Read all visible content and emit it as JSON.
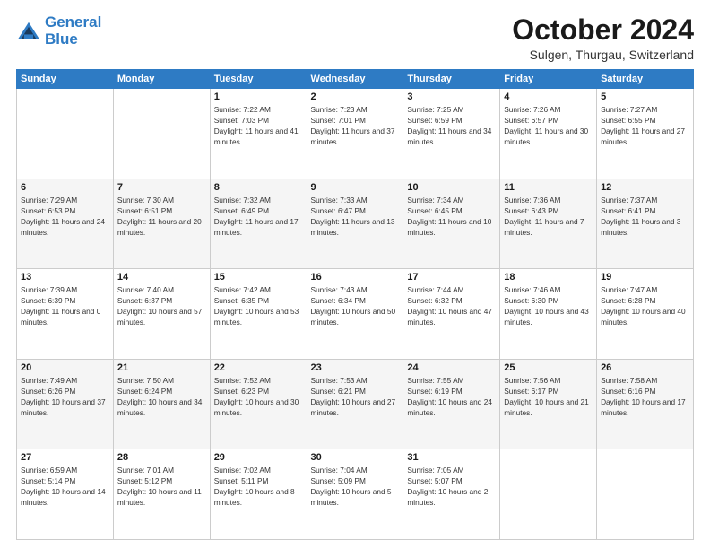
{
  "logo": {
    "line1": "General",
    "line2": "Blue"
  },
  "title": "October 2024",
  "location": "Sulgen, Thurgau, Switzerland",
  "days_header": [
    "Sunday",
    "Monday",
    "Tuesday",
    "Wednesday",
    "Thursday",
    "Friday",
    "Saturday"
  ],
  "weeks": [
    [
      {
        "day": "",
        "info": ""
      },
      {
        "day": "",
        "info": ""
      },
      {
        "day": "1",
        "info": "Sunrise: 7:22 AM\nSunset: 7:03 PM\nDaylight: 11 hours and 41 minutes."
      },
      {
        "day": "2",
        "info": "Sunrise: 7:23 AM\nSunset: 7:01 PM\nDaylight: 11 hours and 37 minutes."
      },
      {
        "day": "3",
        "info": "Sunrise: 7:25 AM\nSunset: 6:59 PM\nDaylight: 11 hours and 34 minutes."
      },
      {
        "day": "4",
        "info": "Sunrise: 7:26 AM\nSunset: 6:57 PM\nDaylight: 11 hours and 30 minutes."
      },
      {
        "day": "5",
        "info": "Sunrise: 7:27 AM\nSunset: 6:55 PM\nDaylight: 11 hours and 27 minutes."
      }
    ],
    [
      {
        "day": "6",
        "info": "Sunrise: 7:29 AM\nSunset: 6:53 PM\nDaylight: 11 hours and 24 minutes."
      },
      {
        "day": "7",
        "info": "Sunrise: 7:30 AM\nSunset: 6:51 PM\nDaylight: 11 hours and 20 minutes."
      },
      {
        "day": "8",
        "info": "Sunrise: 7:32 AM\nSunset: 6:49 PM\nDaylight: 11 hours and 17 minutes."
      },
      {
        "day": "9",
        "info": "Sunrise: 7:33 AM\nSunset: 6:47 PM\nDaylight: 11 hours and 13 minutes."
      },
      {
        "day": "10",
        "info": "Sunrise: 7:34 AM\nSunset: 6:45 PM\nDaylight: 11 hours and 10 minutes."
      },
      {
        "day": "11",
        "info": "Sunrise: 7:36 AM\nSunset: 6:43 PM\nDaylight: 11 hours and 7 minutes."
      },
      {
        "day": "12",
        "info": "Sunrise: 7:37 AM\nSunset: 6:41 PM\nDaylight: 11 hours and 3 minutes."
      }
    ],
    [
      {
        "day": "13",
        "info": "Sunrise: 7:39 AM\nSunset: 6:39 PM\nDaylight: 11 hours and 0 minutes."
      },
      {
        "day": "14",
        "info": "Sunrise: 7:40 AM\nSunset: 6:37 PM\nDaylight: 10 hours and 57 minutes."
      },
      {
        "day": "15",
        "info": "Sunrise: 7:42 AM\nSunset: 6:35 PM\nDaylight: 10 hours and 53 minutes."
      },
      {
        "day": "16",
        "info": "Sunrise: 7:43 AM\nSunset: 6:34 PM\nDaylight: 10 hours and 50 minutes."
      },
      {
        "day": "17",
        "info": "Sunrise: 7:44 AM\nSunset: 6:32 PM\nDaylight: 10 hours and 47 minutes."
      },
      {
        "day": "18",
        "info": "Sunrise: 7:46 AM\nSunset: 6:30 PM\nDaylight: 10 hours and 43 minutes."
      },
      {
        "day": "19",
        "info": "Sunrise: 7:47 AM\nSunset: 6:28 PM\nDaylight: 10 hours and 40 minutes."
      }
    ],
    [
      {
        "day": "20",
        "info": "Sunrise: 7:49 AM\nSunset: 6:26 PM\nDaylight: 10 hours and 37 minutes."
      },
      {
        "day": "21",
        "info": "Sunrise: 7:50 AM\nSunset: 6:24 PM\nDaylight: 10 hours and 34 minutes."
      },
      {
        "day": "22",
        "info": "Sunrise: 7:52 AM\nSunset: 6:23 PM\nDaylight: 10 hours and 30 minutes."
      },
      {
        "day": "23",
        "info": "Sunrise: 7:53 AM\nSunset: 6:21 PM\nDaylight: 10 hours and 27 minutes."
      },
      {
        "day": "24",
        "info": "Sunrise: 7:55 AM\nSunset: 6:19 PM\nDaylight: 10 hours and 24 minutes."
      },
      {
        "day": "25",
        "info": "Sunrise: 7:56 AM\nSunset: 6:17 PM\nDaylight: 10 hours and 21 minutes."
      },
      {
        "day": "26",
        "info": "Sunrise: 7:58 AM\nSunset: 6:16 PM\nDaylight: 10 hours and 17 minutes."
      }
    ],
    [
      {
        "day": "27",
        "info": "Sunrise: 6:59 AM\nSunset: 5:14 PM\nDaylight: 10 hours and 14 minutes."
      },
      {
        "day": "28",
        "info": "Sunrise: 7:01 AM\nSunset: 5:12 PM\nDaylight: 10 hours and 11 minutes."
      },
      {
        "day": "29",
        "info": "Sunrise: 7:02 AM\nSunset: 5:11 PM\nDaylight: 10 hours and 8 minutes."
      },
      {
        "day": "30",
        "info": "Sunrise: 7:04 AM\nSunset: 5:09 PM\nDaylight: 10 hours and 5 minutes."
      },
      {
        "day": "31",
        "info": "Sunrise: 7:05 AM\nSunset: 5:07 PM\nDaylight: 10 hours and 2 minutes."
      },
      {
        "day": "",
        "info": ""
      },
      {
        "day": "",
        "info": ""
      }
    ]
  ]
}
